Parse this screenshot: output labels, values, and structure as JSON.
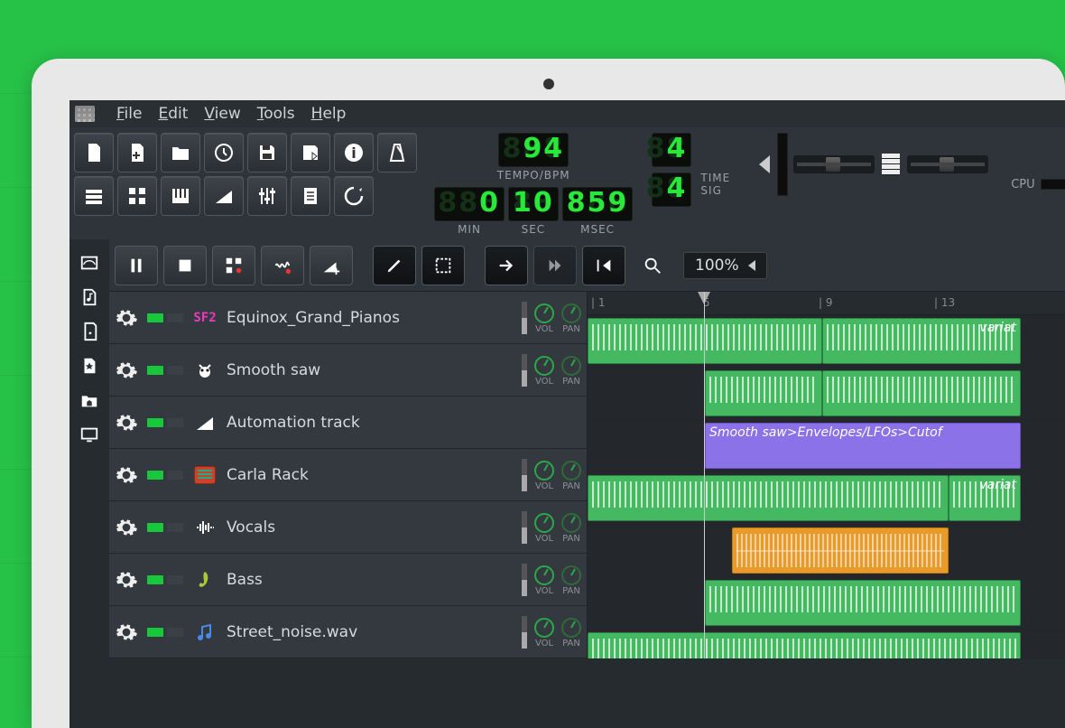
{
  "menu": {
    "items": [
      "File",
      "Edit",
      "View",
      "Tools",
      "Help"
    ]
  },
  "transport": {
    "tempo_bpm": "94",
    "tempo_label": "TEMPO/BPM",
    "min": "0",
    "min_label": "MIN",
    "sec": "10",
    "sec_label": "SEC",
    "msec": "859",
    "msec_label": "MSEC",
    "timesig_num": "4",
    "timesig_den": "4",
    "timesig_label": "TIME SIG",
    "cpu_label": "CPU"
  },
  "song_toolbar": {
    "zoom": "100%"
  },
  "timeline": {
    "ticks": [
      "| 1",
      "5",
      "| 9",
      "| 13"
    ],
    "playhead_bar": 5
  },
  "tracks": [
    {
      "name": "Equinox_Grand_Pianos",
      "icon": "sf2",
      "icon_color": "#e93bb8",
      "vol": "VOL",
      "pan": "PAN",
      "clips": [
        {
          "start": 0,
          "end": 260,
          "type": "pattern"
        },
        {
          "start": 260,
          "end": 480,
          "type": "pattern",
          "label": "variat"
        }
      ]
    },
    {
      "name": "Smooth saw",
      "icon": "bug",
      "icon_color": "#fff",
      "vol": "VOL",
      "pan": "PAN",
      "clips": [
        {
          "start": 130,
          "end": 260,
          "type": "pattern"
        },
        {
          "start": 260,
          "end": 480,
          "type": "pattern"
        }
      ]
    },
    {
      "name": "Automation track",
      "icon": "automation",
      "icon_color": "#fff",
      "vol": "",
      "pan": "",
      "clips": [
        {
          "start": 130,
          "end": 480,
          "type": "automation",
          "label": "Smooth saw>Envelopes/LFOs>Cutof"
        }
      ]
    },
    {
      "name": "Carla Rack",
      "icon": "carla",
      "icon_color": "#c8432a",
      "vol": "VOL",
      "pan": "PAN",
      "clips": [
        {
          "start": 0,
          "end": 400,
          "type": "pattern"
        },
        {
          "start": 400,
          "end": 480,
          "type": "pattern",
          "label": "variat"
        }
      ]
    },
    {
      "name": "Vocals",
      "icon": "waveform",
      "icon_color": "#fff",
      "vol": "VOL",
      "pan": "PAN",
      "clips": [
        {
          "start": 160,
          "end": 400,
          "type": "audio"
        }
      ]
    },
    {
      "name": "Bass",
      "icon": "bass",
      "icon_color": "#a8c838",
      "vol": "VOL",
      "pan": "PAN",
      "clips": [
        {
          "start": 130,
          "end": 480,
          "type": "pattern"
        }
      ]
    },
    {
      "name": "Street_noise.wav",
      "icon": "sample",
      "icon_color": "#4a88e8",
      "vol": "VOL",
      "pan": "PAN",
      "clips": [
        {
          "start": 0,
          "end": 480,
          "type": "pattern"
        }
      ]
    }
  ]
}
